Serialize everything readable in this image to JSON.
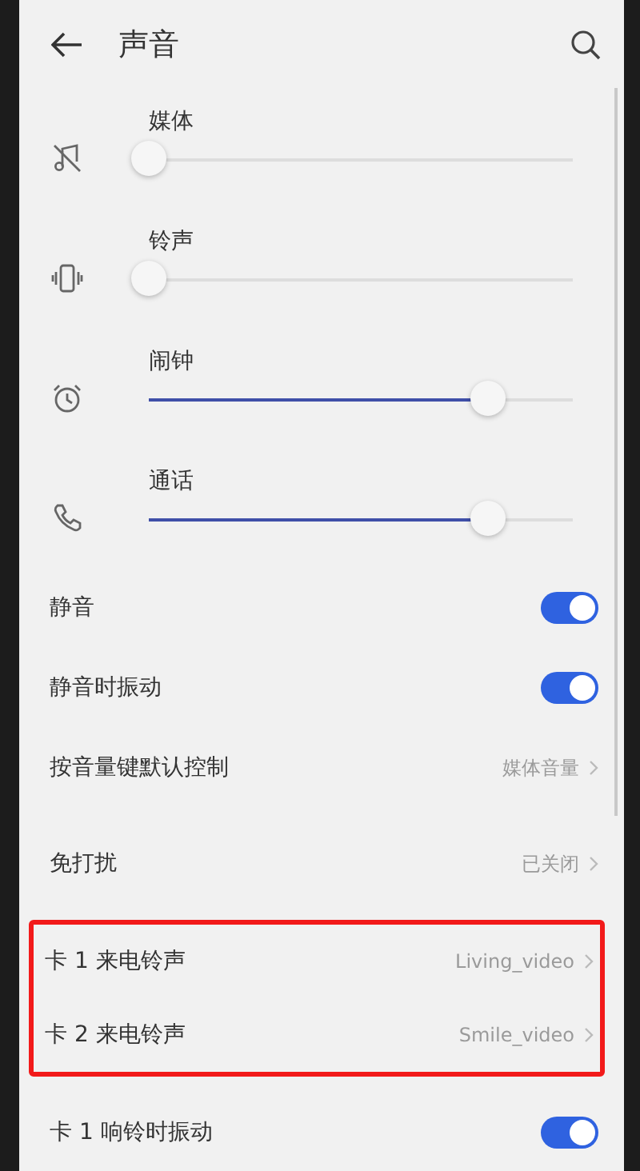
{
  "header": {
    "title": "声音"
  },
  "sliders": [
    {
      "kind": "media",
      "label": "媒体",
      "level": 0
    },
    {
      "kind": "ring",
      "label": "铃声",
      "level": 0
    },
    {
      "kind": "alarm",
      "label": "闹钟",
      "level": 0.8
    },
    {
      "kind": "call",
      "label": "通话",
      "level": 0.8
    }
  ],
  "sections": [
    {
      "highlighted": false,
      "rows": [
        {
          "kind": "toggle",
          "label": "静音",
          "on": true
        },
        {
          "kind": "toggle",
          "label": "静音时振动",
          "on": true
        },
        {
          "kind": "link",
          "label": "按音量键默认控制",
          "value": "媒体音量"
        }
      ]
    },
    {
      "highlighted": false,
      "rows": [
        {
          "kind": "link",
          "label": "免打扰",
          "value": "已关闭"
        }
      ]
    },
    {
      "highlighted": true,
      "rows": [
        {
          "kind": "link",
          "label": "卡 1 来电铃声",
          "value": "Living_video"
        },
        {
          "kind": "link",
          "label": "卡 2 来电铃声",
          "value": "Smile_video"
        }
      ]
    },
    {
      "highlighted": false,
      "rows": [
        {
          "kind": "toggle",
          "label": "卡 1 响铃时振动",
          "on": true
        }
      ]
    }
  ]
}
